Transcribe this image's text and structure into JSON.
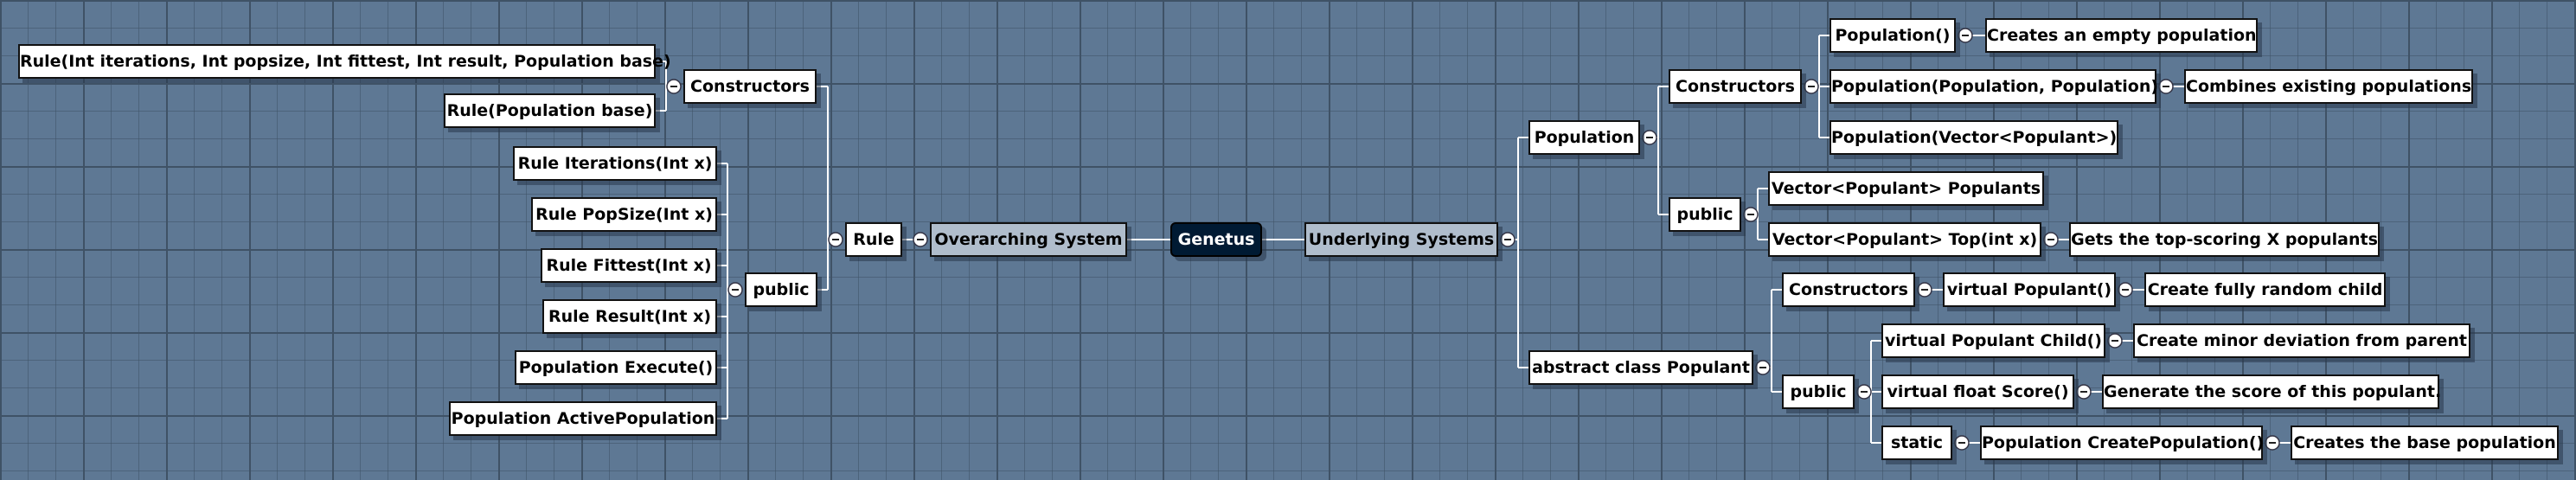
{
  "root": "Genetus",
  "nodes": {
    "r_ctor_full": "Rule(Int iterations, Int popsize, Int fittest, Int result, Population base)",
    "r_ctor_base": "Rule(Population base)",
    "r_ctors": "Constructors",
    "r_iter": "Rule Iterations(Int x)",
    "r_pop": "Rule PopSize(Int x)",
    "r_fit": "Rule Fittest(Int x)",
    "r_res": "Rule Result(Int x)",
    "r_exec": "Population Execute()",
    "r_active": "Population ActivePopulation",
    "r_public": "public",
    "rule": "Rule",
    "overarching": "Overarching System",
    "genetus": "Genetus",
    "underlying": "Underlying Systems",
    "population": "Population",
    "p_ctors": "Constructors",
    "p_ctor0": "Population()",
    "p_ctor0_d": "Creates an empty population",
    "p_ctor1": "Population(Population, Population)",
    "p_ctor1_d": "Combines existing populations",
    "p_ctor2": "Population(Vector<Populant>)",
    "p_public": "public",
    "p_pops": "Vector<Populant> Populants",
    "p_top": "Vector<Populant> Top(int x)",
    "p_top_d": "Gets the top-scoring X populants",
    "populant": "abstract class Populant",
    "q_ctors": "Constructors",
    "q_ctor": "virtual Populant()",
    "q_ctor_d": "Create fully random child",
    "q_public": "public",
    "q_child": "virtual Populant Child()",
    "q_child_d": "Create minor deviation from parent",
    "q_score": "virtual float Score()",
    "q_score_d": "Generate the score of this populant.",
    "q_static": "static",
    "q_create": "Population CreatePopulation()",
    "q_create_d": "Creates the base population"
  },
  "colors": {
    "background": "#5e7894",
    "root": "#001a33",
    "system": "#b0bdcc",
    "node": "#ffffff",
    "connector": "#ffffff"
  },
  "icons": {
    "collapse": "minus-circle-icon"
  }
}
